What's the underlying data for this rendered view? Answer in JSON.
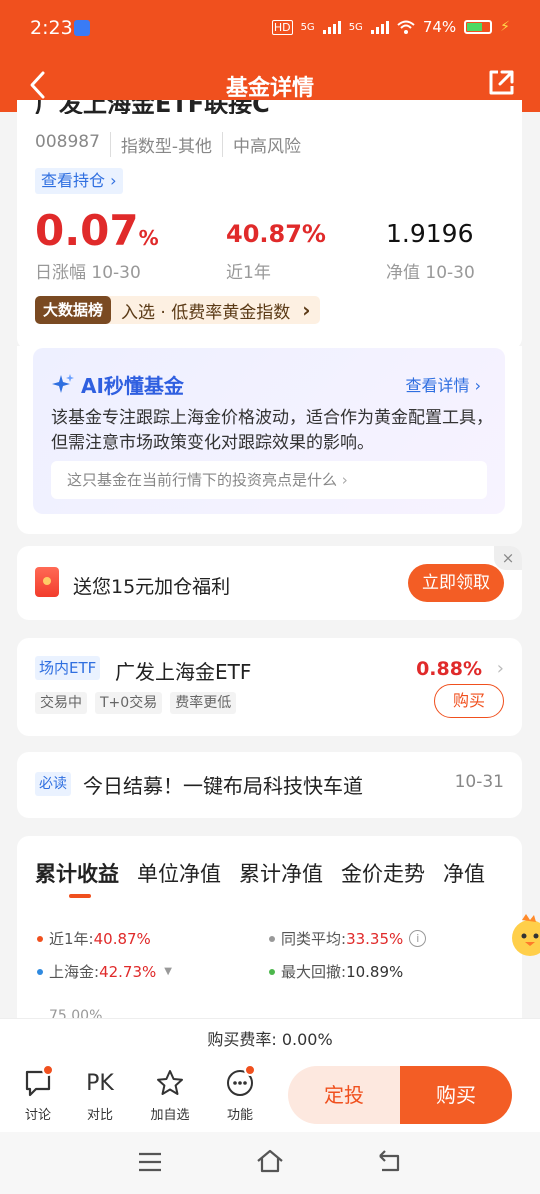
{
  "status_bar": {
    "time": "2:23",
    "network1": "5G",
    "network2": "5G",
    "battery": "74%"
  },
  "header": {
    "title": "基金详情"
  },
  "fund": {
    "name_partial": "广发上海金ETF联接C",
    "code": "008987",
    "category": "指数型-其他",
    "risk": "中高风险",
    "holdings_link": "查看持仓",
    "daily_change_value": "0.07",
    "daily_change_unit": "%",
    "daily_change_label": "日涨幅 10-30",
    "year_return": "40.87%",
    "year_return_label": "近1年",
    "nav": "1.9196",
    "nav_label": "净值 10-30",
    "rank_badge": "大数据榜",
    "rank_text": "入选 · 低费率黄金指数"
  },
  "ai": {
    "title": "AI秒懂基金",
    "more": "查看详情",
    "summary": "该基金专注跟踪上海金价格波动，适合作为黄金配置工具，但需注意市场政策变化对跟踪效果的影响。",
    "question": "这只基金在当前行情下的投资亮点是什么"
  },
  "promo": {
    "text": "送您15元加仓福利",
    "button": "立即领取",
    "close": "×"
  },
  "etf": {
    "tag": "场内ETF",
    "name": "广发上海金ETF",
    "change": "0.88%",
    "chips": [
      "交易中",
      "T+0交易",
      "费率更低"
    ],
    "buy": "购买"
  },
  "news": {
    "tag": "必读",
    "title": "今日结募！一键布局科技快车道",
    "date": "10-31"
  },
  "chart_tabs": [
    "累计收益",
    "单位净值",
    "累计净值",
    "金价走势",
    "净值"
  ],
  "chart_legend": {
    "this_label": "近1年:",
    "this_value": "40.87%",
    "peer_label": "同类平均:",
    "peer_value": "33.35%",
    "bench_label": "上海金:",
    "bench_value": "42.73%",
    "dd_label": "最大回撤:",
    "dd_value": "10.89%",
    "colors": {
      "this": "#f0501e",
      "peer": "#999999",
      "bench": "#2f8ae0",
      "dd": "#4cb74c"
    }
  },
  "chart_y_top": "75.00%",
  "fee": {
    "label": "购买费率:",
    "value": "0.00%"
  },
  "bottom_nav": [
    {
      "label": "讨论",
      "icon": "chat-icon"
    },
    {
      "label": "对比",
      "icon": "pk-icon",
      "glyph": "PK"
    },
    {
      "label": "加自选",
      "icon": "star-icon"
    },
    {
      "label": "功能",
      "icon": "more-icon"
    }
  ],
  "actions": {
    "auto_invest": "定投",
    "buy": "购买"
  }
}
